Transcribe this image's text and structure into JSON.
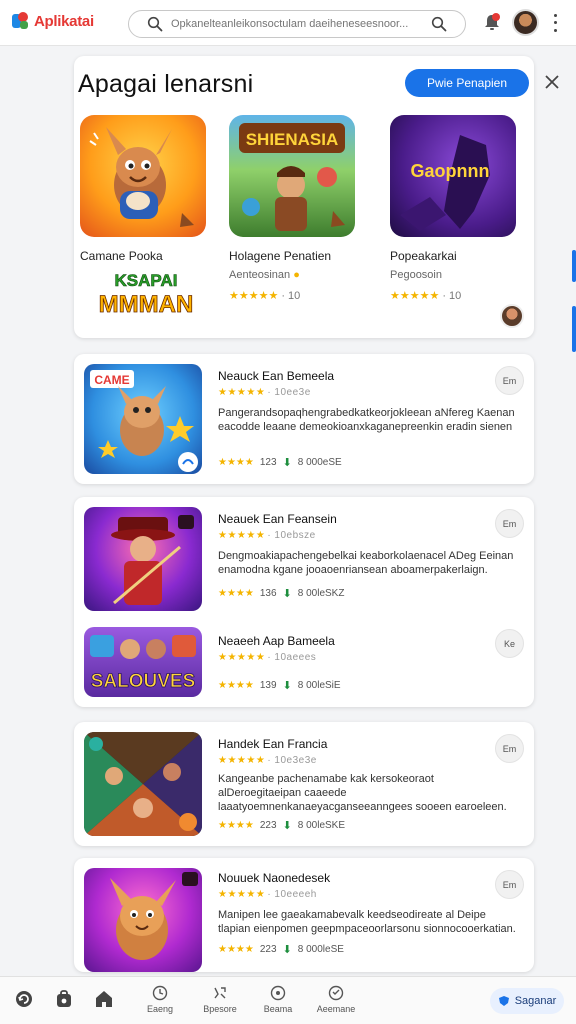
{
  "app": {
    "logo_text": "Aplikatai"
  },
  "search": {
    "placeholder": "Opkanelteanleikonsoctulam daeiheneseesnoor..."
  },
  "featured": {
    "title": "Apagai lenarsni",
    "primary_button": "Pwie Penapien",
    "games": [
      {
        "name": "Camane Pooka",
        "sub": "",
        "stars": "★★★★★",
        "count": ""
      },
      {
        "name": "Holagene Penatien",
        "sub": "Aenteosinan",
        "stars": "★★★★★",
        "count": "· 10"
      },
      {
        "name": "Popeakarkai",
        "sub": "Pegoosoin",
        "stars": "★★★★★",
        "count": "· 10"
      }
    ],
    "thumb_texts": {
      "second": "SHIENASIA",
      "third": "Gaopnnn"
    },
    "overlay_logo_top": "KSAPAI",
    "overlay_logo_bottom": "MMMAN"
  },
  "list": [
    {
      "name": "Neauck Ean Bemeela",
      "stars": "★★★★★",
      "star_count": "· 10ee3e",
      "desc": "Pangerandsopaqhengrabedkatkeorjokleean aNfereg Kaenan eacodde leaane demeokioanxkaganepreenkin eradin sienen",
      "meta_stars": "★★★★",
      "meta_rating": "123",
      "downloads": "8 000eSE",
      "more": "Em",
      "badge": "CAME"
    },
    {
      "name": "Neauek Ean Feansein",
      "stars": "★★★★★",
      "star_count": "· 10ebsze",
      "desc": "Dengmoakiapachengebelkai keaborkolaenacel ADeg Eeinan enamodna kgane jooaoenriansean aboamerpakerlaign.",
      "meta_stars": "★★★★",
      "meta_rating": "136",
      "downloads": "8 00leSKZ",
      "more": "Em"
    },
    {
      "name": "Neaeeh Aap Bameela",
      "stars": "★★★★★",
      "star_count": "· 10aeees",
      "desc": "",
      "meta_stars": "★★★★",
      "meta_rating": "139",
      "downloads": "8 00leSiE",
      "more": "Ke",
      "thumb_text": "SALOUVES"
    },
    {
      "name": "Handek Ean Francia",
      "stars": "★★★★★",
      "star_count": "· 10e3e3e",
      "desc": "Kangeanbe pachenamabe kak kersokeoraot alDeroegitaeipan caaeede laaatyoemnenkanaeyacganseeanngees sooeen earoeleen.",
      "meta_stars": "★★★★",
      "meta_rating": "223",
      "downloads": "8 00leSKE",
      "more": "Em"
    },
    {
      "name": "Nouuek Naonedesek",
      "stars": "★★★★★",
      "star_count": "· 10eeeeh",
      "desc": "Manipen lee gaeakamabevalk keedseodireate al Deipe tlapian eienpomen geepmpaceoorlarsonu sionnocooerkatian.",
      "meta_stars": "★★★★",
      "meta_rating": "223",
      "downloads": "8 000leSE",
      "more": "Em"
    }
  ],
  "bottom_nav": {
    "items": [
      {
        "label": "Eaeng"
      },
      {
        "label": "Bpesore"
      },
      {
        "label": "Beama"
      },
      {
        "label": "Aeemane"
      }
    ],
    "chip_label": "Saganar"
  },
  "colors": {
    "accent": "#1a73e8",
    "star": "#f4b400",
    "logo": "#e53935"
  }
}
